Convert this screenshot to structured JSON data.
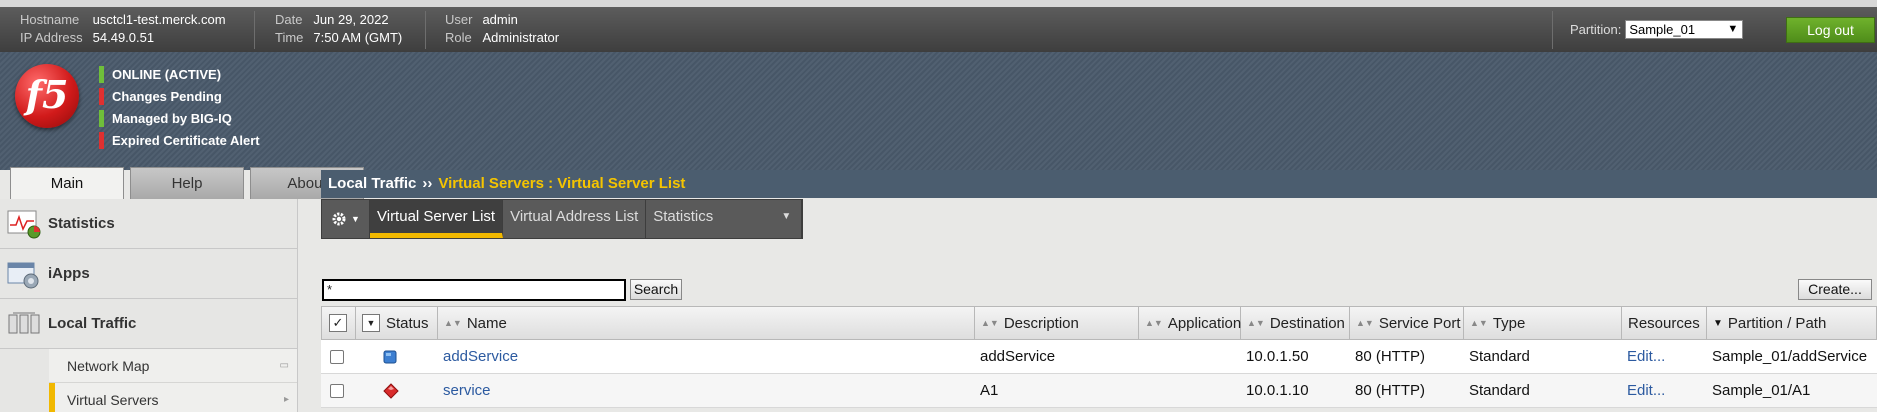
{
  "header": {
    "hostname_label": "Hostname",
    "hostname": "usctcl1-test.merck.com",
    "ip_label": "IP Address",
    "ip": "54.49.0.51",
    "date_label": "Date",
    "date": "Jun 29, 2022",
    "time_label": "Time",
    "time": "7:50 AM (GMT)",
    "user_label": "User",
    "user": "admin",
    "role_label": "Role",
    "role": "Administrator",
    "partition_label": "Partition:",
    "partition_value": "Sample_01",
    "logout_label": "Log out"
  },
  "banner": {
    "logo_text": "f5",
    "status": [
      {
        "label": "ONLINE (ACTIVE)",
        "color": "#6fbf3a"
      },
      {
        "label": "Changes Pending",
        "color": "#e03030"
      },
      {
        "label": "Managed by BIG-IQ",
        "color": "#6fbf3a"
      },
      {
        "label": "Expired Certificate Alert",
        "color": "#e03030"
      }
    ]
  },
  "tabs": [
    "Main",
    "Help",
    "About"
  ],
  "sidebar": {
    "items": [
      "Statistics",
      "iApps",
      "Local Traffic"
    ],
    "sub_items": [
      "Network Map",
      "Virtual Servers"
    ]
  },
  "breadcrumb": {
    "section": "Local Traffic",
    "separator": "››",
    "current": "Virtual Servers : Virtual Server List"
  },
  "subtabs": [
    "Virtual Server List",
    "Virtual Address List",
    "Statistics"
  ],
  "search": {
    "value": "*",
    "button": "Search",
    "create_button": "Create..."
  },
  "table": {
    "columns": [
      "Status",
      "Name",
      "Description",
      "Application",
      "Destination",
      "Service Port",
      "Type",
      "Resources",
      "Partition / Path"
    ],
    "rows": [
      {
        "name": "addService",
        "description": "addService",
        "application": "",
        "destination": "10.0.1.50",
        "port": "80 (HTTP)",
        "type": "Standard",
        "resources": "Edit...",
        "partition": "Sample_01/addService",
        "status_icon": "blue-square-status-icon"
      },
      {
        "name": "service",
        "description": "A1",
        "application": "",
        "destination": "10.0.1.10",
        "port": "80 (HTTP)",
        "type": "Standard",
        "resources": "Edit...",
        "partition": "Sample_01/A1",
        "status_icon": "red-diamond-status-icon"
      }
    ]
  }
}
